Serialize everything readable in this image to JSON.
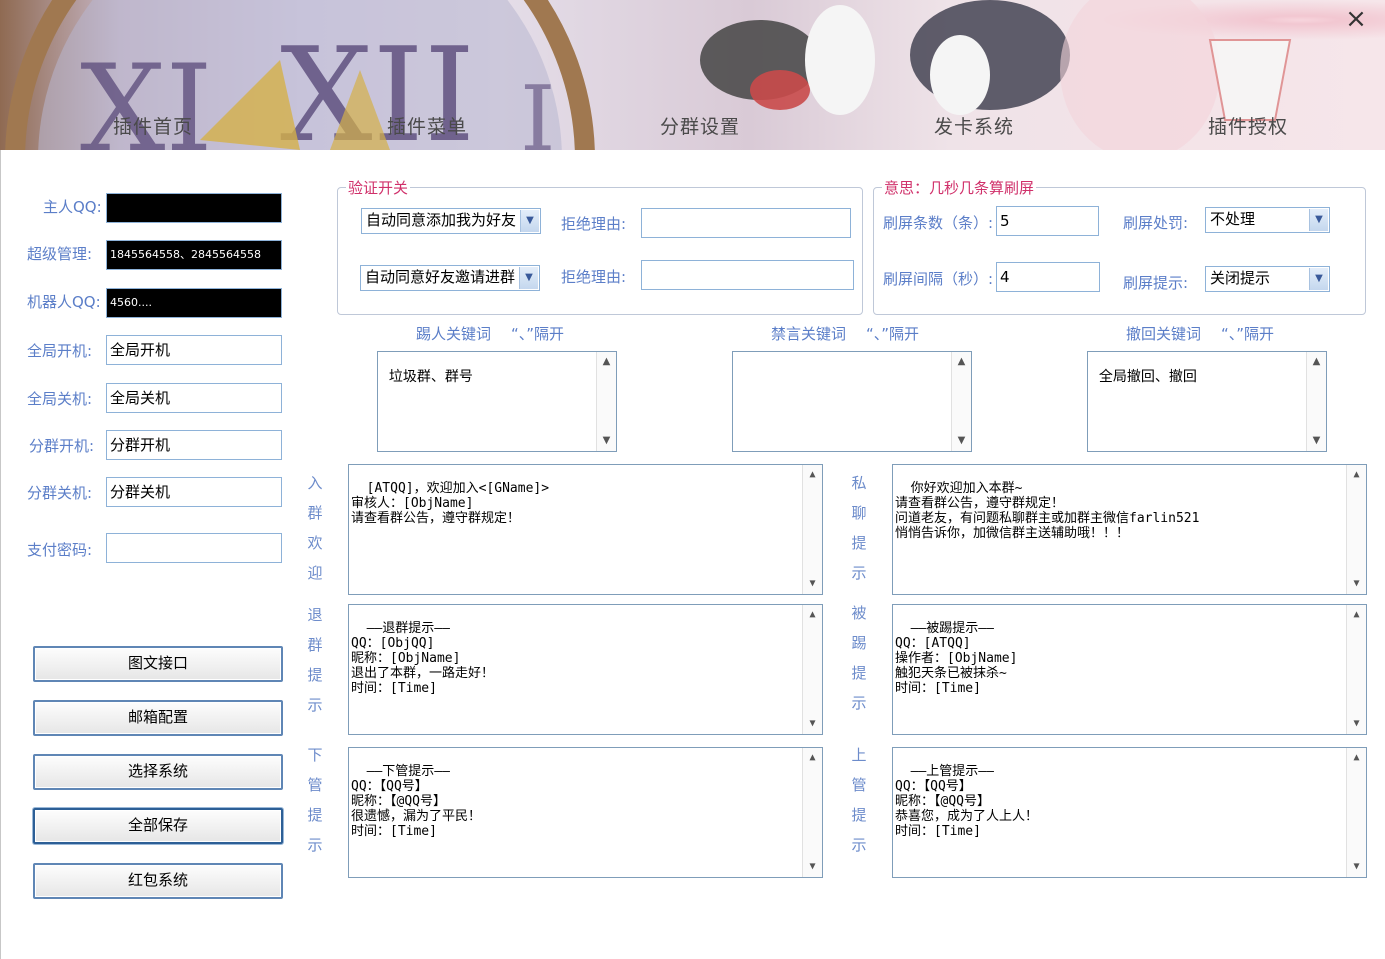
{
  "window": {
    "close_label": "×",
    "tabs": [
      "插件首页",
      "插件菜单",
      "分群设置",
      "发卡系统",
      "插件授权"
    ]
  },
  "left": {
    "fields": [
      {
        "label": "主人QQ:",
        "value": "",
        "masked": true
      },
      {
        "label": "超级管理:",
        "value": "1845564558、2845564558",
        "masked": true
      },
      {
        "label": "机器人QQ:",
        "value": "4560....",
        "masked": true
      },
      {
        "label": "全局开机:",
        "value": "全局开机"
      },
      {
        "label": "全局关机:",
        "value": "全局关机"
      },
      {
        "label": "分群开机:",
        "value": "分群开机"
      },
      {
        "label": "分群关机:",
        "value": "分群关机"
      },
      {
        "label": "支付密码:",
        "value": ""
      }
    ],
    "buttons": [
      "图文接口",
      "邮箱配置",
      "选择系统",
      "全部保存",
      "红包系统"
    ]
  },
  "verify": {
    "legend": "验证开关",
    "select1": "自动同意添加我为好友",
    "select2": "自动同意好友邀请进群",
    "reject_label": "拒绝理由:",
    "reject1": "",
    "reject2": ""
  },
  "flood": {
    "legend": "意思：几秒几条算刷屏",
    "count_label": "刷屏条数（条）:",
    "count_value": "5",
    "interval_label": "刷屏间隔（秒）:",
    "interval_value": "4",
    "punish_label": "刷屏处罚:",
    "punish_value": "不处理",
    "tip_label": "刷屏提示:",
    "tip_value": "关闭提示"
  },
  "keywords": [
    {
      "title": "踢人关键词",
      "sep": "“、”隔开",
      "content": "垃圾群、群号"
    },
    {
      "title": "禁言关键词",
      "sep": "“、”隔开",
      "content": ""
    },
    {
      "title": "撤回关键词",
      "sep": "“、”隔开",
      "content": "全局撤回、撤回"
    }
  ],
  "messages": {
    "join": {
      "label": [
        "入",
        "群",
        "欢",
        "迎"
      ],
      "text": "[ATQQ]，欢迎加入<[GName]>\n审核人：[ObjName]\n请查看群公告，遵守群规定！"
    },
    "private": {
      "label": [
        "私",
        "聊",
        "提",
        "示"
      ],
      "text": "你好欢迎加入本群~\n请查看群公告，遵守群规定！\n问道老友，有问题私聊群主或加群主微信farlin521\n悄悄告诉你，加微信群主送辅助哦！！！"
    },
    "leave": {
      "label": [
        "退",
        "群",
        "提",
        "示"
      ],
      "text": "——退群提示——\nQQ：[ObjQQ]\n昵称：[ObjName]\n退出了本群，一路走好！\n时间：[Time]"
    },
    "kicked": {
      "label": [
        "被",
        "踢",
        "提",
        "示"
      ],
      "text": "——被踢提示——\nQQ：[ATQQ]\n操作者：[ObjName]\n触犯天条已被抹杀~\n时间：[Time]"
    },
    "demote": {
      "label": [
        "下",
        "管",
        "提",
        "示"
      ],
      "text": "——下管提示——\nQQ：【QQ号】\n昵称：【@QQ号】\n很遗憾，漏为了平民！\n时间：[Time]"
    },
    "promote": {
      "label": [
        "上",
        "管",
        "提",
        "示"
      ],
      "text": "——上管提示——\nQQ：【QQ号】\n昵称：【@QQ号】\n恭喜您，成为了人上人！\n时间：[Time]"
    }
  },
  "icons": {
    "up": "▲",
    "down": "▼"
  },
  "colors": {
    "label_blue": "#5b7ec8",
    "legend_pink": "#d0306a",
    "border_blue": "#8eb2d8"
  }
}
